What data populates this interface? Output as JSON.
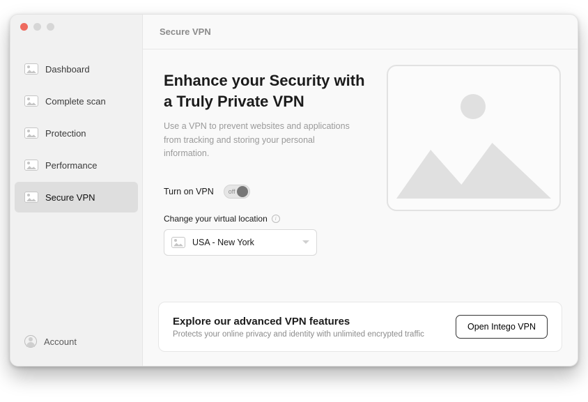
{
  "header": {
    "title": "Secure VPN"
  },
  "sidebar": {
    "items": [
      {
        "label": "Dashboard",
        "active": false
      },
      {
        "label": "Complete scan",
        "active": false
      },
      {
        "label": "Protection",
        "active": false
      },
      {
        "label": "Performance",
        "active": false
      },
      {
        "label": "Secure VPN",
        "active": true
      }
    ],
    "account_label": "Account"
  },
  "vpn": {
    "title_line1": "Enhance your Security with",
    "title_line2": "a Truly Private VPN",
    "subtitle": "Use a VPN to prevent websites and applications from tracking and storing your personal information.",
    "toggle_label": "Turn on VPN",
    "toggle_state": "off",
    "location_label": "Change your virtual location",
    "location_value": "USA - New York"
  },
  "promo": {
    "title": "Explore our advanced VPN features",
    "subtitle": "Protects your online privacy and identity with unlimited encrypted traffic",
    "button": "Open Intego VPN"
  }
}
